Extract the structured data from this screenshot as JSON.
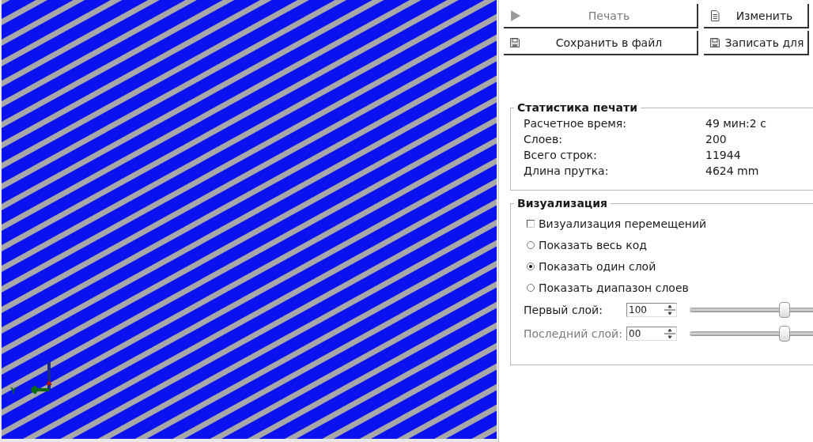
{
  "toolbar": {
    "buttons": [
      {
        "label": "Печать",
        "kind": "play",
        "disabled": true
      },
      {
        "label": "Изменить",
        "kind": "document",
        "disabled": false
      },
      {
        "label": "Сохранить в файл",
        "kind": "save",
        "disabled": false
      },
      {
        "label": "Записать для",
        "kind": "save",
        "disabled": false
      }
    ]
  },
  "print_stats": {
    "title": "Статистика печати",
    "rows": [
      {
        "label": "Расчетное время:",
        "value": "49 мин:2 с"
      },
      {
        "label": "Слоев:",
        "value": "200"
      },
      {
        "label": "Всего строк:",
        "value": "11944"
      },
      {
        "label": "Длина прутка:",
        "value": "4624 mm"
      }
    ]
  },
  "visualization": {
    "title": "Визуализация",
    "options": [
      {
        "kind": "checkbox",
        "label": "Визуализация перемещений",
        "checked": false
      },
      {
        "kind": "radio",
        "label": "Показать весь код",
        "selected": false
      },
      {
        "kind": "radio",
        "label": "Показать один слой",
        "selected": true
      },
      {
        "kind": "radio",
        "label": "Показать диапазон слоев",
        "selected": false
      }
    ],
    "layers": [
      {
        "label": "Первый слой:",
        "value": "100",
        "level": 0.4,
        "disabled": false
      },
      {
        "label": "Последний слой:",
        "value": "00",
        "level": 0.4,
        "disabled": true
      }
    ]
  }
}
